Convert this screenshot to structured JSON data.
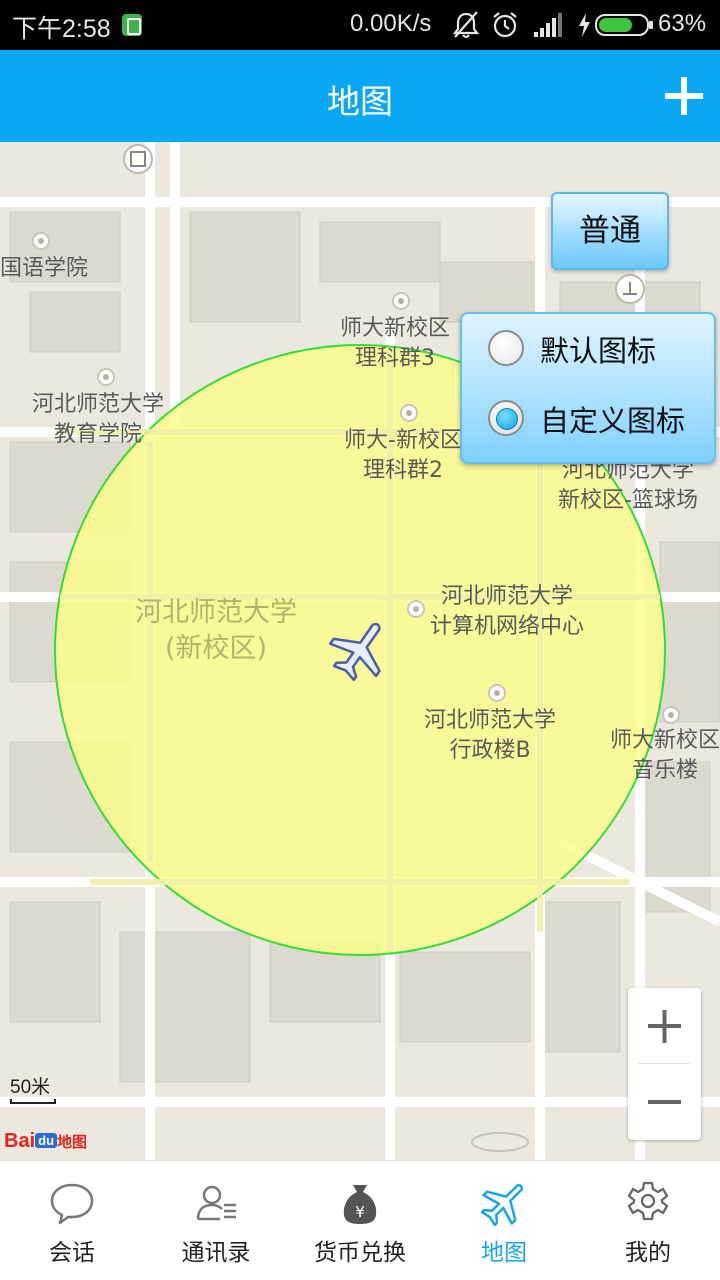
{
  "status_bar": {
    "time": "下午2:58",
    "speed": "0.00K/s",
    "battery_percent": "63%"
  },
  "header": {
    "title": "地图",
    "add_icon": "plus-icon"
  },
  "map": {
    "map_type_button": "普通",
    "icon_options": [
      {
        "label": "默认图标",
        "selected": false
      },
      {
        "label": "自定义图标",
        "selected": true
      }
    ],
    "labels": {
      "foreign_lang": "国语学院",
      "edu_1": "河北师范大学",
      "edu_2": "教育学院",
      "sci3_1": "师大新校区",
      "sci3_2": "理科群3",
      "sci2_1": "师大-新校区",
      "sci2_2": "理科群2",
      "court_1": "河北师范大学",
      "court_2": "新校区-篮球场",
      "campus_1": "河北师范大学",
      "campus_2": "(新校区)",
      "net_1": "河北师范大学",
      "net_2": "计算机网络中心",
      "admin_1": "河北师范大学",
      "admin_2": "行政楼B",
      "music_1": "师大新校区",
      "music_2": "音乐楼"
    },
    "scale_text": "50米",
    "logo": {
      "bai": "Bai",
      "du": "du",
      "map": "地图"
    },
    "circle_fill": "#fbfb8c",
    "circle_stroke": "#33dd33",
    "marker_icon": "airplane-icon"
  },
  "bottom_nav": [
    {
      "label": "会话",
      "icon": "chat-bubble-icon",
      "active": false
    },
    {
      "label": "通讯录",
      "icon": "contacts-icon",
      "active": false
    },
    {
      "label": "货币兑换",
      "icon": "money-bag-icon",
      "active": false
    },
    {
      "label": "地图",
      "icon": "airplane-icon",
      "active": true
    },
    {
      "label": "我的",
      "icon": "gear-icon",
      "active": false
    }
  ],
  "colors": {
    "accent": "#0aa8f4",
    "active_nav": "#1aa3ea"
  }
}
